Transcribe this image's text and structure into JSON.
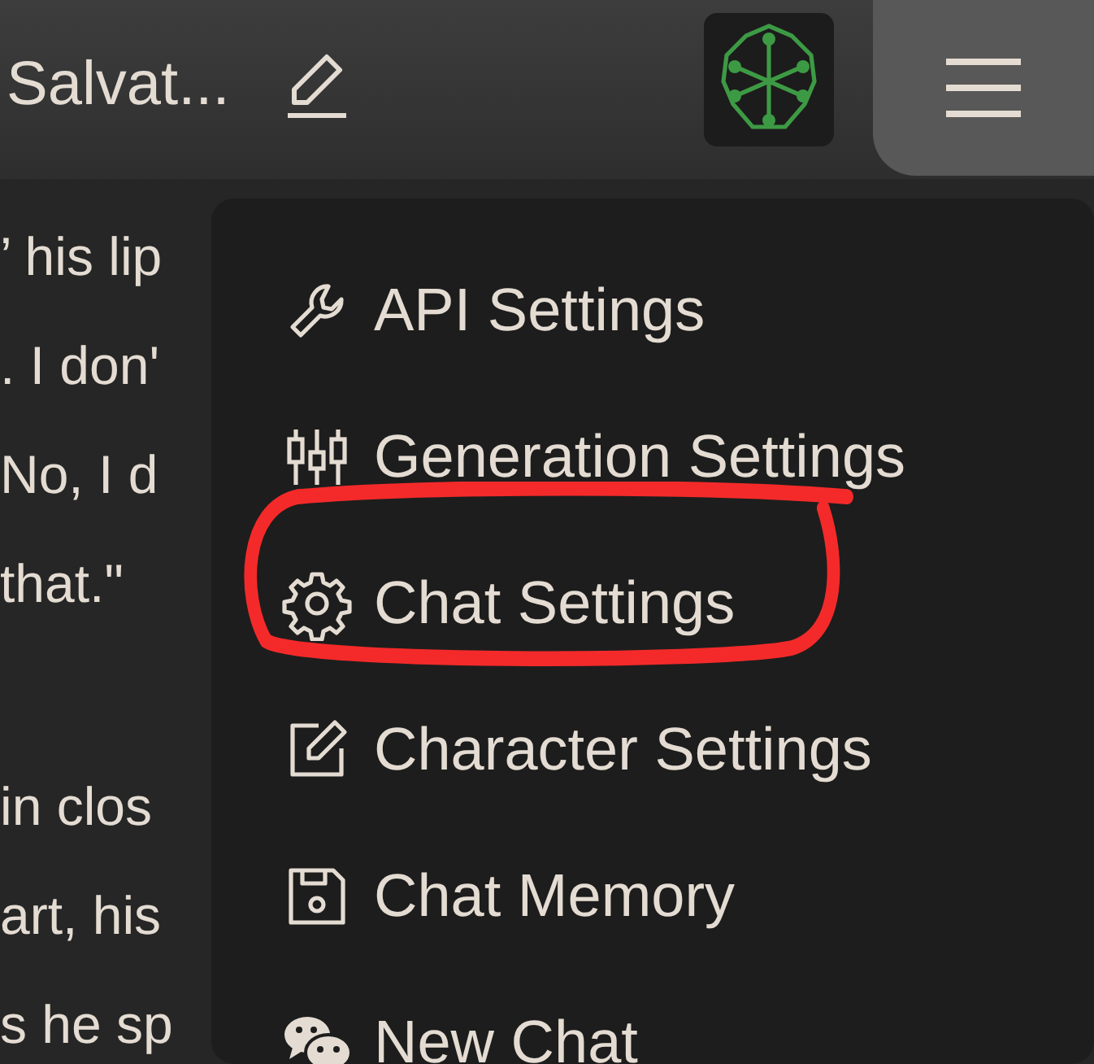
{
  "header": {
    "title": "Salvat..."
  },
  "chat_lines": [
    {
      "text": "’ his lip"
    },
    {
      "text": ". I don'"
    },
    {
      "text": "No, I d"
    },
    {
      "text": "that.\""
    },
    {
      "text": "in clos",
      "paragraph_start": true
    },
    {
      "text": "art, his"
    },
    {
      "text": "s he sp"
    }
  ],
  "menu": {
    "items": [
      {
        "kind": "wrench",
        "label": "API Settings",
        "annotated": false
      },
      {
        "kind": "sliders",
        "label": "Generation Settings",
        "annotated": false
      },
      {
        "kind": "gear",
        "label": "Chat Settings",
        "annotated": true
      },
      {
        "kind": "edit",
        "label": "Character Settings",
        "annotated": false
      },
      {
        "kind": "save",
        "label": "Chat Memory",
        "annotated": false
      },
      {
        "kind": "chat",
        "label": "New Chat",
        "annotated": false
      }
    ]
  }
}
